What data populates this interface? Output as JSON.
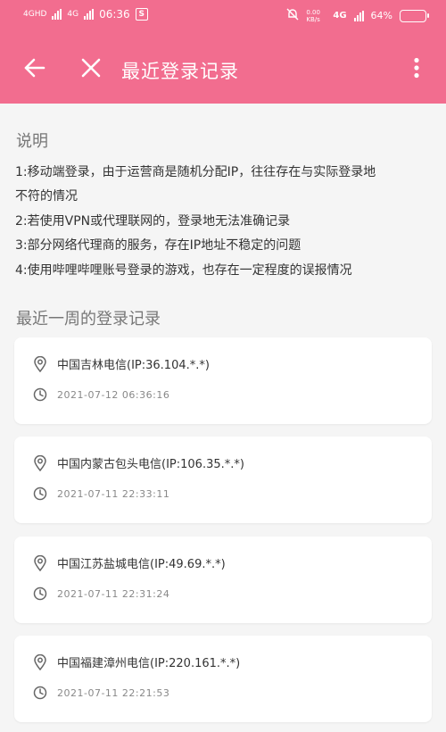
{
  "status_bar": {
    "signal1": "4GHD",
    "signal2": "4G",
    "time": "06:36",
    "speed": "0.00 KB/s",
    "net": "4G",
    "battery": "64%",
    "battery_level": 0.64
  },
  "toolbar": {
    "title": "最近登录记录"
  },
  "notes": {
    "heading": "说明",
    "lines": [
      "1:移动端登录，由于运营商是随机分配IP，往往存在与实际登录地",
      "不符的情况",
      "2:若使用VPN或代理联网的，登录地无法准确记录",
      "3:部分网络代理商的服务，存在IP地址不稳定的问题",
      "4:使用哔哩哔哩账号登录的游戏，也存在一定程度的误报情况"
    ]
  },
  "records": {
    "heading": "最近一周的登录记录",
    "items": [
      {
        "location": "中国吉林电信(IP:36.104.*.*)",
        "time": "2021-07-12 06:36:16"
      },
      {
        "location": "中国内蒙古包头电信(IP:106.35.*.*)",
        "time": "2021-07-11 22:33:11"
      },
      {
        "location": "中国江苏盐城电信(IP:49.69.*.*)",
        "time": "2021-07-11 22:31:24"
      },
      {
        "location": "中国福建漳州电信(IP:220.161.*.*)",
        "time": "2021-07-11 22:21:53"
      }
    ]
  },
  "colors": {
    "accent": "#f26d8f",
    "background": "#f5f5f5"
  }
}
